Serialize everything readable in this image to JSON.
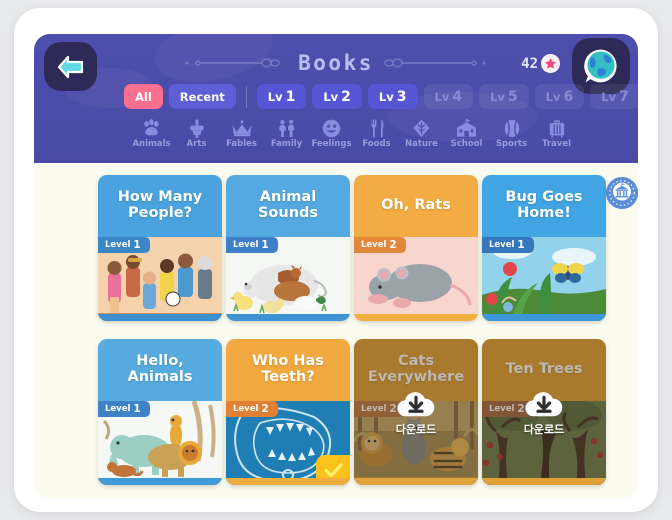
{
  "header": {
    "title": "Books",
    "back_icon": "back-arrow-icon",
    "globe_icon": "globe-speech-bubble-icon",
    "star_count": "42",
    "star_icon": "star-icon",
    "colors": {
      "header_bg": "#4a4aa6",
      "accent_pink": "#fc6f8e",
      "chip_active": "#5656d4",
      "cyan": "#5fd8e3"
    }
  },
  "filters": {
    "all_label": "All",
    "recent_label": "Recent",
    "levels": [
      {
        "prefix": "Lv",
        "num": "1",
        "active": true
      },
      {
        "prefix": "Lv",
        "num": "2",
        "active": true
      },
      {
        "prefix": "Lv",
        "num": "3",
        "active": true
      },
      {
        "prefix": "Lv",
        "num": "4",
        "active": false
      },
      {
        "prefix": "Lv",
        "num": "5",
        "active": false
      },
      {
        "prefix": "Lv",
        "num": "6",
        "active": false
      },
      {
        "prefix": "Lv",
        "num": "7",
        "active": false
      }
    ]
  },
  "categories": [
    {
      "label": "Animals",
      "icon": "paw-icon"
    },
    {
      "label": "Arts",
      "icon": "paintbrush-icon"
    },
    {
      "label": "Fables",
      "icon": "crown-icon"
    },
    {
      "label": "Family",
      "icon": "family-icon"
    },
    {
      "label": "Feelings",
      "icon": "smiley-face-icon"
    },
    {
      "label": "Foods",
      "icon": "fork-knife-icon"
    },
    {
      "label": "Nature",
      "icon": "leaf-icon"
    },
    {
      "label": "School",
      "icon": "school-building-icon"
    },
    {
      "label": "Sports",
      "icon": "ball-icon"
    },
    {
      "label": "Travel",
      "icon": "suitcase-icon"
    }
  ],
  "museum_button": {
    "icon": "museum-badge-icon"
  },
  "books": [
    {
      "title": "How Many\nPeople?",
      "level_label": "Level",
      "level_num": "1",
      "top_bg": "#4aa3de",
      "badge_bg": "#3b86c4",
      "art_bg": "#f3cfa8",
      "foot_bg": "#3c8fcf",
      "state": "normal"
    },
    {
      "title": "Animal\nSounds",
      "level_label": "Level",
      "level_num": "1",
      "top_bg": "#54a9e0",
      "badge_bg": "#3f7fc9",
      "art_bg": "#f2f5f3",
      "foot_bg": "#3f93d2",
      "state": "normal"
    },
    {
      "title": "Oh, Rats",
      "level_label": "Level",
      "level_num": "2",
      "top_bg": "#f3ab43",
      "badge_bg": "#e2873a",
      "art_bg": "#f7d3cb",
      "foot_bg": "#efae3e",
      "state": "normal"
    },
    {
      "title": "Bug Goes\nHome!",
      "level_label": "Level",
      "level_num": "1",
      "top_bg": "#40a5e2",
      "badge_bg": "#3577bd",
      "art_bg": "#8fd0ea",
      "foot_bg": "#3c97d8",
      "state": "normal"
    },
    {
      "title": "Hello,\nAnimals",
      "level_label": "Level",
      "level_num": "1",
      "top_bg": "#57abdf",
      "badge_bg": "#3f82c6",
      "art_bg": "#f4f7f3",
      "foot_bg": "#3f9ad6",
      "state": "normal"
    },
    {
      "title": "Who Has\nTeeth?",
      "level_label": "Level",
      "level_num": "2",
      "top_bg": "#f2a93f",
      "badge_bg": "#e07f36",
      "art_bg": "#1f7fb5",
      "foot_bg": "#f0ad3f",
      "state": "completed",
      "check_icon": "check-icon"
    },
    {
      "title": "Cats\nEverywhere",
      "level_label": "Level",
      "level_num": "2",
      "top_bg": "#e2a238",
      "badge_bg": "#c07a44",
      "art_bg": "#9b8450",
      "foot_bg": "#e0a23b",
      "state": "download",
      "download_label": "다운로드",
      "download_icon": "cloud-download-icon"
    },
    {
      "title": "Ten Trees",
      "level_label": "Level",
      "level_num": "2",
      "top_bg": "#e3a234",
      "badge_bg": "#a86a43",
      "art_bg": "#6b7a4c",
      "foot_bg": "#dfa037",
      "state": "download",
      "download_label": "다운로드",
      "download_icon": "cloud-download-icon"
    }
  ]
}
